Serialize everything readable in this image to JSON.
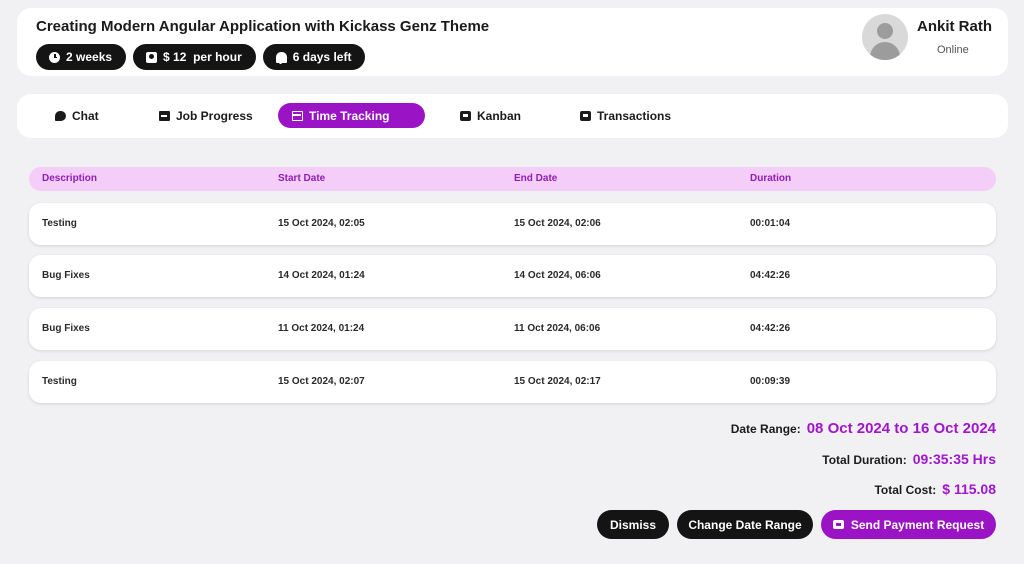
{
  "header": {
    "title": "Creating Modern Angular Application with Kickass Genz Theme",
    "chips": [
      {
        "icon": "clock-icon",
        "label": "2 weeks"
      },
      {
        "icon": "money-icon",
        "label": "$ 12  per hour"
      },
      {
        "icon": "bell-icon",
        "label": "6 days left"
      }
    ],
    "user": {
      "name": "Ankit Rath",
      "status": "Online"
    }
  },
  "tabs": [
    {
      "label": "Chat",
      "icon": "chat-icon",
      "active": false
    },
    {
      "label": "Job Progress",
      "icon": "progress-icon",
      "active": false
    },
    {
      "label": "Time Tracking",
      "icon": "table-icon",
      "active": true
    },
    {
      "label": "Kanban",
      "icon": "kanban-icon",
      "active": false
    },
    {
      "label": "Transactions",
      "icon": "transactions-icon",
      "active": false
    }
  ],
  "table": {
    "columns": [
      "Description",
      "Start Date",
      "End Date",
      "Duration"
    ],
    "rows": [
      {
        "description": "Testing",
        "start": "15 Oct 2024, 02:05",
        "end": "15 Oct 2024, 02:06",
        "duration": "00:01:04"
      },
      {
        "description": "Bug Fixes",
        "start": "14 Oct 2024, 01:24",
        "end": "14 Oct 2024, 06:06",
        "duration": "04:42:26"
      },
      {
        "description": "Bug Fixes",
        "start": "11 Oct 2024, 01:24",
        "end": "11 Oct 2024, 06:06",
        "duration": "04:42:26"
      },
      {
        "description": "Testing",
        "start": "15 Oct 2024, 02:07",
        "end": "15 Oct 2024, 02:17",
        "duration": "00:09:39"
      }
    ]
  },
  "summary": {
    "date_range_label": "Date Range:",
    "date_range_value": "08 Oct 2024 to 16 Oct 2024",
    "total_duration_label": "Total Duration:",
    "total_duration_value": "09:35:35 Hrs",
    "total_cost_label": "Total Cost:",
    "total_cost_value": "$ 115.08"
  },
  "buttons": {
    "dismiss": "Dismiss",
    "change_date_range": "Change Date Range",
    "send_payment_request": "Send Payment Request"
  },
  "colors": {
    "accent": "#9a14c6",
    "header_row_bg": "#f4cdf8",
    "dark": "#141414",
    "page_bg": "#f1f1f3"
  }
}
